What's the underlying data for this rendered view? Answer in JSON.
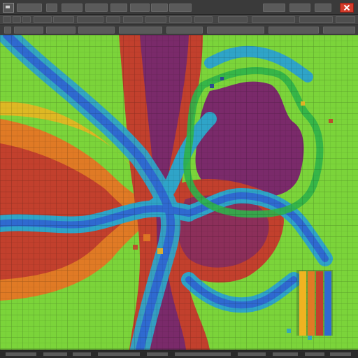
{
  "window": {
    "close_icon": "close-icon",
    "logo_icon": "app-logo-icon"
  },
  "colors": {
    "titlebar": "#3a3a3a",
    "toolbar": "#454545",
    "close_button": "#d33b2a"
  },
  "map": {
    "palette": [
      "#7a2a6a",
      "#c2402d",
      "#e07a25",
      "#f0b321",
      "#d8e32a",
      "#7bd43a",
      "#2fb24a",
      "#2fa4c8",
      "#2f6ad0",
      "#2a3c9a"
    ]
  },
  "legend": {
    "colors": [
      "#f0b321",
      "#e07a25",
      "#c2402d",
      "#2f6ad0"
    ]
  }
}
